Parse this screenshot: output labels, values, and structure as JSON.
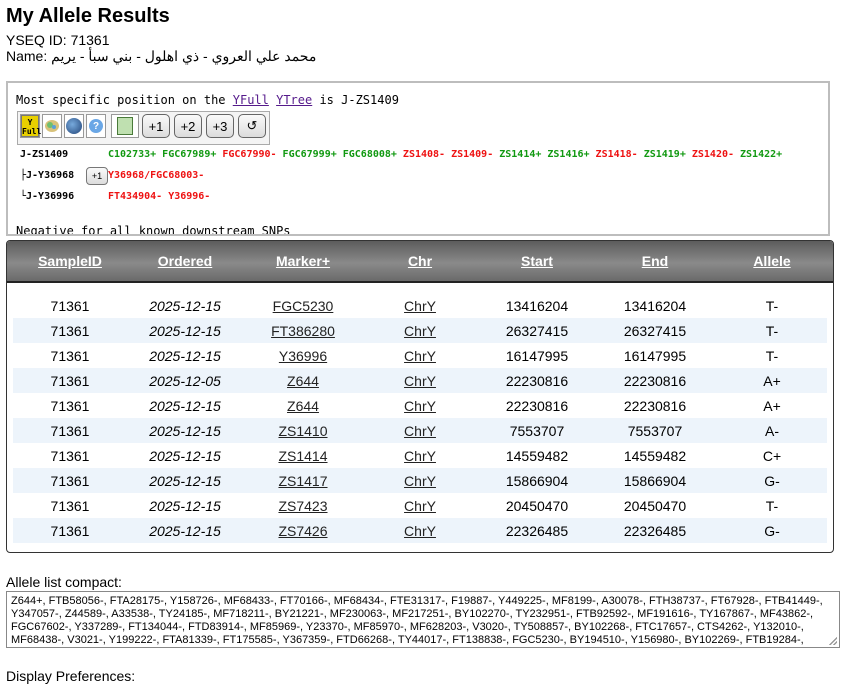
{
  "page": {
    "title": "My Allele Results",
    "yseq_line": "YSEQ ID: 71361",
    "name_line": "Name: محمد علي العروي - ذي اهلول - بني سبأ - يريم"
  },
  "yfull": {
    "msp_prefix": "Most specific position on the ",
    "yfull_link": "YFull",
    "ytree_link": "YTree",
    "msp_suffix": " is J-ZS1409",
    "toolbar_buttons": [
      "+1",
      "+2",
      "+3",
      "↺"
    ],
    "rows": [
      {
        "node": "J-ZS1409",
        "snps": [
          {
            "t": "C102733+",
            "pos": true
          },
          {
            "t": "FGC67989+",
            "pos": true
          },
          {
            "t": "FGC67990-",
            "pos": false
          },
          {
            "t": "FGC67999+",
            "pos": true
          },
          {
            "t": "FGC68008+",
            "pos": true
          },
          {
            "t": "ZS1408-",
            "pos": false
          },
          {
            "t": "ZS1409-",
            "pos": false
          },
          {
            "t": "ZS1414+",
            "pos": true
          },
          {
            "t": "ZS1416+",
            "pos": true
          },
          {
            "t": "ZS1418-",
            "pos": false
          },
          {
            "t": "ZS1419+",
            "pos": true
          },
          {
            "t": "ZS1420-",
            "pos": false
          },
          {
            "t": "ZS1422+",
            "pos": true
          }
        ]
      },
      {
        "node": "├J-Y36968",
        "button": "+1",
        "snps": [
          {
            "t": "Y36968/FGC68003-",
            "pos": false
          }
        ]
      },
      {
        "node": "└J-Y36996",
        "snps": [
          {
            "t": "FT434904-",
            "pos": false
          },
          {
            "t": "Y36996-",
            "pos": false
          }
        ]
      }
    ],
    "negative_text": "Negative for all known downstream SNPs"
  },
  "table": {
    "headers": [
      "SampleID",
      "Ordered",
      "Marker+",
      "Chr",
      "Start",
      "End",
      "Allele"
    ],
    "rows": [
      [
        "71361",
        "2025-12-15",
        "FGC5230",
        "ChrY",
        "13416204",
        "13416204",
        "T-"
      ],
      [
        "71361",
        "2025-12-15",
        "FT386280",
        "ChrY",
        "26327415",
        "26327415",
        "T-"
      ],
      [
        "71361",
        "2025-12-15",
        "Y36996",
        "ChrY",
        "16147995",
        "16147995",
        "T-"
      ],
      [
        "71361",
        "2025-12-05",
        "Z644",
        "ChrY",
        "22230816",
        "22230816",
        "A+"
      ],
      [
        "71361",
        "2025-12-15",
        "Z644",
        "ChrY",
        "22230816",
        "22230816",
        "A+"
      ],
      [
        "71361",
        "2025-12-15",
        "ZS1410",
        "ChrY",
        "7553707",
        "7553707",
        "A-"
      ],
      [
        "71361",
        "2025-12-15",
        "ZS1414",
        "ChrY",
        "14559482",
        "14559482",
        "C+"
      ],
      [
        "71361",
        "2025-12-15",
        "ZS1417",
        "ChrY",
        "15866904",
        "15866904",
        "G-"
      ],
      [
        "71361",
        "2025-12-15",
        "ZS7423",
        "ChrY",
        "20450470",
        "20450470",
        "T-"
      ],
      [
        "71361",
        "2025-12-15",
        "ZS7426",
        "ChrY",
        "22326485",
        "22326485",
        "G-"
      ]
    ]
  },
  "compact": {
    "label": "Allele list compact:",
    "text": "Z644+, FTB58056-, FTA28175-, Y158726-, MF68433-, FT70166-, MF68434-, FTE31317-, F19887-, Y449225-, MF8199-, A30078-, FTH38737-, FT67928-, FTB41449-, Y347057-, Z44589-, A33538-, TY24185-, MF718211-, BY21221-, MF230063-, MF217251-, BY102270-, TY232951-, FTB92592-, MF191616-, TY167867-, MF43862-, FGC67602-, Y337289-, FT134044-, FTD83914-, MF85969-, Y23370-, MF85970-, MF628203-, V3020-, TY508857-, BY102268-, FTC17657-, CTS4262-, Y132010-, MF68438-, V3021-, Y199222-, FTA81339-, FT175585-, Y367359-, FTD66268-, TY44017-, FT138838-, FGC5230-, BY194510-, Y156980-, BY102269-, FTB19284-,"
  },
  "prefs": {
    "label": "Display Preferences:"
  },
  "colors": {
    "positive": "#119911",
    "negative": "#ee1111",
    "link": "#551a8b"
  }
}
